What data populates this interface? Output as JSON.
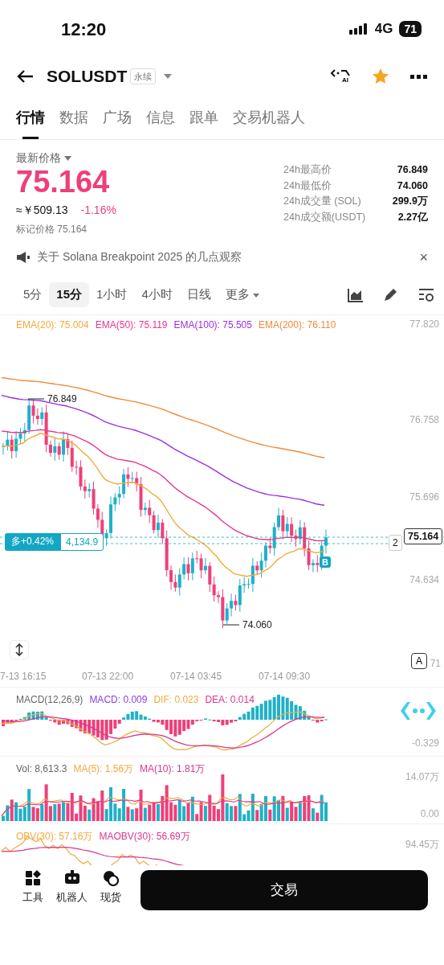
{
  "status_bar": {
    "time": "12:20",
    "network": "4G",
    "battery": "71"
  },
  "header": {
    "symbol": "SOLUSDT",
    "badge": "永续",
    "ai_label": "AI",
    "favorite": true
  },
  "tabs": [
    {
      "label": "行情",
      "selected": true
    },
    {
      "label": "数据",
      "selected": false
    },
    {
      "label": "广场",
      "selected": false
    },
    {
      "label": "信息",
      "selected": false
    },
    {
      "label": "跟单",
      "selected": false
    },
    {
      "label": "交易机器人",
      "selected": false
    }
  ],
  "price": {
    "label": "最新价格",
    "last": "75.164",
    "approx": "≈￥509.13",
    "change": "-1.16%",
    "mark": "标记价格 75.164"
  },
  "stats": [
    {
      "label": "24h最高价",
      "value": "76.849"
    },
    {
      "label": "24h最低价",
      "value": "74.060"
    },
    {
      "label": "24h成交量 (SOL)",
      "value": "299.9万"
    },
    {
      "label": "24h成交额(USDT)",
      "value": "2.27亿"
    }
  ],
  "announcement": {
    "text": "关于 Solana Breakpoint 2025 的几点观察",
    "close": "×"
  },
  "intervals": [
    {
      "label": "5分",
      "kind": "interval",
      "selected": false
    },
    {
      "label": "15分",
      "kind": "interval",
      "selected": true
    },
    {
      "label": "1小时",
      "kind": "interval",
      "selected": false
    },
    {
      "label": "4小时",
      "kind": "interval",
      "selected": false
    },
    {
      "label": "日线",
      "kind": "interval",
      "selected": false
    },
    {
      "label": "更多",
      "kind": "menu",
      "selected": false
    }
  ],
  "main_chart": {
    "legend": [
      {
        "text": "EMA(20): 75.004",
        "color": "#f2a93b"
      },
      {
        "text": "EMA(50): 75.119",
        "color": "#e8368f"
      },
      {
        "text": "EMA(100): 75.505",
        "color": "#9b30e0"
      },
      {
        "text": "EMA(200): 76.110",
        "color": "#f08a3c"
      }
    ],
    "y_axis": [
      "77.820",
      "76.758",
      "75.696",
      "74.634"
    ],
    "y_axis_cut": "71",
    "high_label": "76.849",
    "low_label": "74.060",
    "position": {
      "side": "多+0.42%",
      "amount": "4,134.9"
    },
    "last_price_tag": "75.164",
    "order_count": "2",
    "signal": "B",
    "auto_button": "A",
    "x_axis": [
      "7-13 16:15",
      "07-13 22:00",
      "07-14 03:45",
      "07-14 09:30"
    ]
  },
  "macd": {
    "legend": [
      {
        "text": "MACD(12,26,9)",
        "color": "#666666"
      },
      {
        "text": "MACD: 0.009",
        "color": "#8a3ee8"
      },
      {
        "text": "DIF: 0.023",
        "color": "#e8b040"
      },
      {
        "text": "DEA: 0.014",
        "color": "#d9368f"
      }
    ],
    "y_axis": [
      "-0.329"
    ]
  },
  "volume": {
    "legend": [
      {
        "text": "Vol: 8,613.3",
        "color": "#666666"
      },
      {
        "text": "MA(5): 1.56万",
        "color": "#f2a93b"
      },
      {
        "text": "MA(10): 1.81万",
        "color": "#d9368f"
      }
    ],
    "y_axis": [
      "14.07万",
      "0.00"
    ]
  },
  "obv": {
    "legend": [
      {
        "text": "OBV(30): 57.16万",
        "color": "#f2a93b"
      },
      {
        "text": "MAOBV(30): 56.69万",
        "color": "#d9368f"
      }
    ],
    "y_axis": [
      "94.45万"
    ]
  },
  "bottom_bar": {
    "items": [
      {
        "label": "工具",
        "kind": "tools"
      },
      {
        "label": "机器人",
        "kind": "robot"
      },
      {
        "label": "现货",
        "kind": "spot"
      }
    ],
    "trade_button": "交易"
  }
}
